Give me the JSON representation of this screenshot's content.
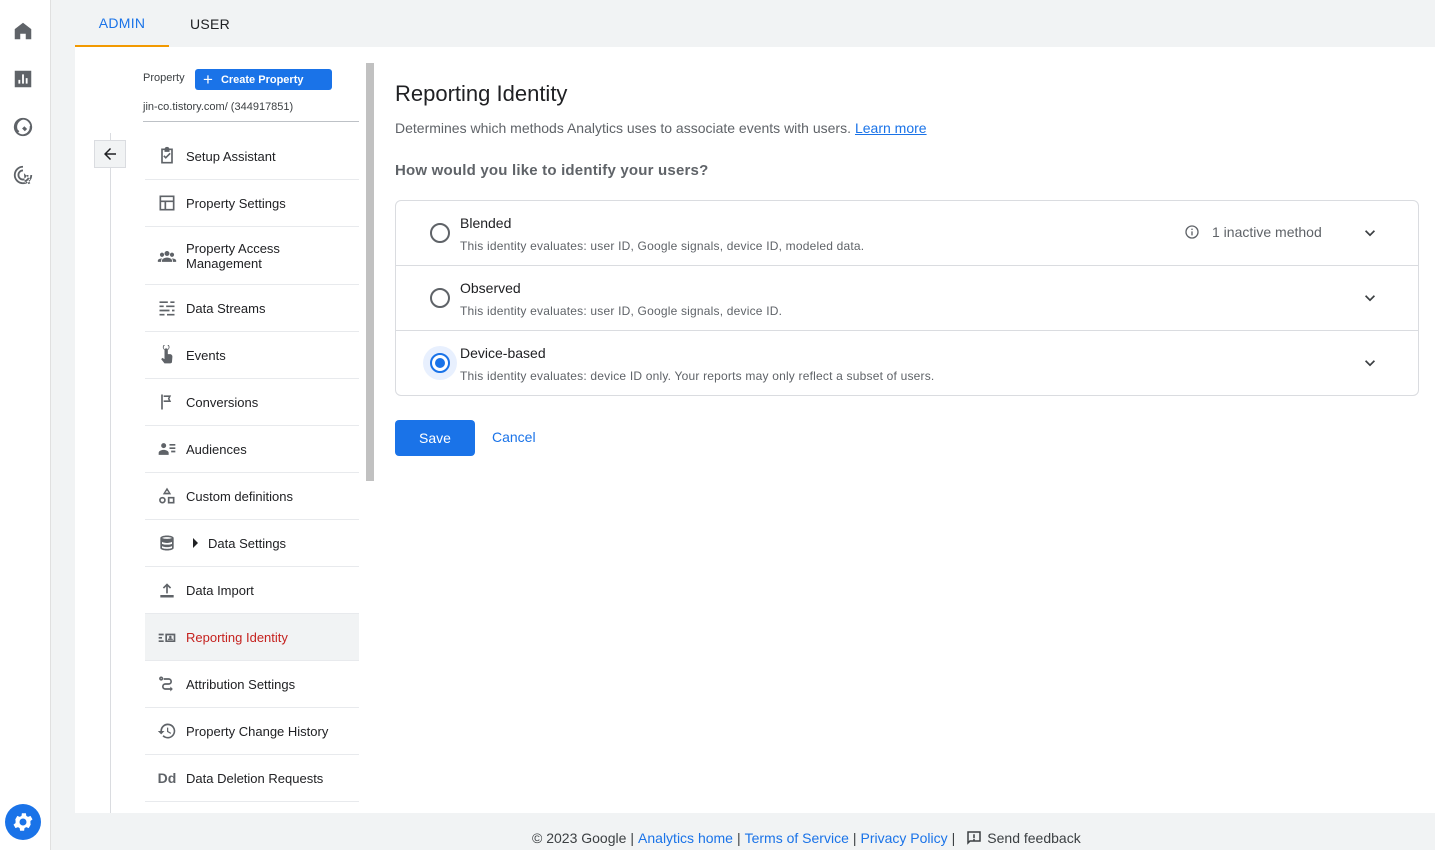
{
  "tabs": [
    {
      "label": "ADMIN",
      "active": true
    },
    {
      "label": "USER",
      "active": false
    }
  ],
  "rail": {
    "icons": [
      "home-icon",
      "reports-icon",
      "explore-icon",
      "advertising-icon",
      "settings-icon"
    ]
  },
  "property": {
    "label": "Property",
    "create_label": "Create Property",
    "name": "jin-co.tistory.com/ (344917851)"
  },
  "nav": {
    "items": [
      {
        "label": "Setup Assistant",
        "icon": "checklist-icon"
      },
      {
        "label": "Property Settings",
        "icon": "layout-icon"
      },
      {
        "label": "Property Access Management",
        "icon": "people-icon"
      },
      {
        "label": "Data Streams",
        "icon": "streams-icon"
      },
      {
        "label": "Events",
        "icon": "touch-icon"
      },
      {
        "label": "Conversions",
        "icon": "flag-icon"
      },
      {
        "label": "Audiences",
        "icon": "audience-icon"
      },
      {
        "label": "Custom definitions",
        "icon": "shapes-icon"
      },
      {
        "label": "Data Settings",
        "icon": "database-icon"
      },
      {
        "label": "Data Import",
        "icon": "upload-icon"
      },
      {
        "label": "Reporting Identity",
        "icon": "identity-icon",
        "active": true
      },
      {
        "label": "Attribution Settings",
        "icon": "attribution-icon"
      },
      {
        "label": "Property Change History",
        "icon": "history-icon"
      },
      {
        "label": "Data Deletion Requests",
        "icon": "dd-icon",
        "icon_text": "Dd"
      }
    ]
  },
  "main": {
    "title": "Reporting Identity",
    "description": "Determines which methods Analytics uses to associate events with users.",
    "learn_more": "Learn more",
    "question": "How would you like to identify your users?",
    "options": [
      {
        "title": "Blended",
        "desc": "This identity evaluates: user ID, Google signals, device ID, modeled data.",
        "note": "1 inactive method",
        "selected": false
      },
      {
        "title": "Observed",
        "desc": "This identity evaluates: user ID, Google signals, device ID.",
        "selected": false
      },
      {
        "title": "Device-based",
        "desc": "This identity evaluates: device ID only. Your reports may only reflect a subset of users.",
        "selected": true
      }
    ],
    "save_label": "Save",
    "cancel_label": "Cancel"
  },
  "footer": {
    "copyright": "© 2023 Google",
    "analytics_home": "Analytics home",
    "terms": "Terms of Service",
    "privacy": "Privacy Policy",
    "feedback": "Send feedback"
  },
  "colors": {
    "accent": "#1a73e8",
    "active_nav_text": "#c5221f",
    "tab_indicator": "#f29900"
  }
}
